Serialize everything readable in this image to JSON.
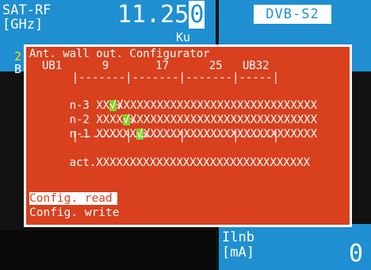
{
  "top_left": {
    "label_line1": "SAT-RF",
    "label_line2": "[GHz]",
    "value_main": "11.25",
    "value_cursor_digit": "0",
    "unit_partial": "Ku",
    "side_char_1": "2",
    "side_char_2": "B"
  },
  "top_right": {
    "standard": "DVB-S2"
  },
  "bottom_right": {
    "label_line1": "Ilnb",
    "label_line2": "[mA]",
    "value": "0"
  },
  "dialog": {
    "title": "Ant. wall out. Configurator",
    "ub_header": "UB1      9       17      25   UB32",
    "ruler_top": "    |-------|-------|-------|-----|",
    "rows": [
      {
        "label": "n-3",
        "before": "XX",
        "mark": "√√",
        "after": "XXXXXXXXXXXXXXXXXXXXXXXXXXXXXX"
      },
      {
        "label": "n-2",
        "before": "XXXX",
        "mark": "√√",
        "after": "XXXXXXXXXXXXXXXXXXXXXXXXXXXX"
      },
      {
        "label": "n-1",
        "before": "XXXXXX",
        "mark": "√√",
        "after": "XXXXXXXXXXXXXXXXXXXXXXXXXX"
      }
    ],
    "ruler_bottom": "    |-------|-------|-------|-----|",
    "act_label": "act.",
    "act_value": "XXXXXXXXXXXXXXXXXXXXXXXXXXXXXXXX",
    "menu": [
      {
        "label": "Config. read",
        "selected": true
      },
      {
        "label": "Config. write",
        "selected": false
      }
    ]
  },
  "colors": {
    "panel_blue": "#1f8fd1",
    "dialog_red": "#d8401e",
    "mark_green": "#7fd22a"
  }
}
